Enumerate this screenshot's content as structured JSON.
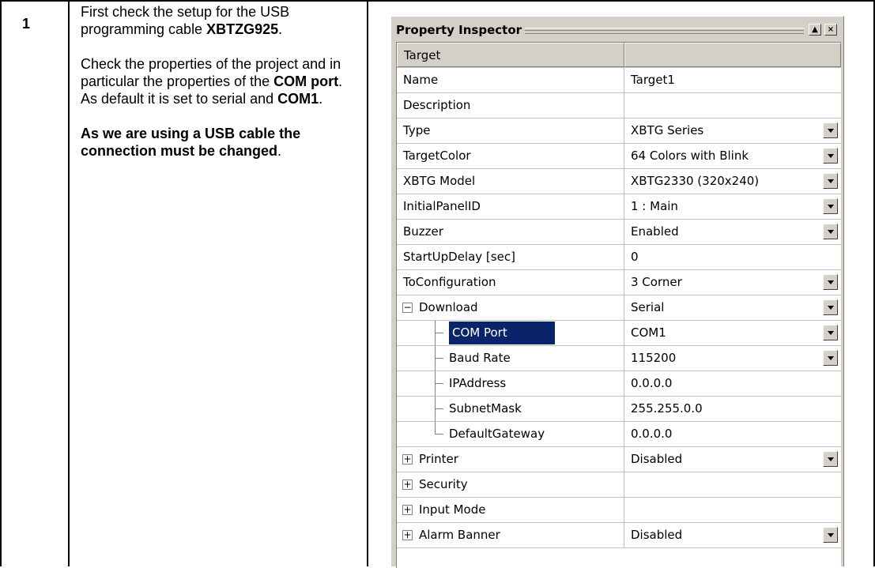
{
  "step": {
    "number": "1"
  },
  "instructions": {
    "p1_prefix": "First check the setup for the USB programming cable ",
    "p1_bold": "XBTZG925",
    "p1_suffix": ".",
    "p2_a": "Check the properties of the project and in particular the properties of the ",
    "p2_bold1": "COM port",
    "p2_b": ". As default it is set to serial and ",
    "p2_bold2": "COM1",
    "p2_c": ".",
    "p3_bold": "As we are using a USB cable the connection must be changed",
    "p3_suffix": "."
  },
  "inspector": {
    "title": "Property Inspector",
    "header": {
      "name": "Target",
      "value": ""
    },
    "rows": [
      {
        "name": "Name",
        "value": "Target1",
        "dropdown": false
      },
      {
        "name": "Description",
        "value": "",
        "dropdown": false
      },
      {
        "name": "Type",
        "value": "XBTG Series",
        "dropdown": true
      },
      {
        "name": "TargetColor",
        "value": "64 Colors with Blink",
        "dropdown": true
      },
      {
        "name": "XBTG Model",
        "value": "XBTG2330 (320x240)",
        "dropdown": true
      },
      {
        "name": "InitialPanelID",
        "value": "1 : Main",
        "dropdown": true
      },
      {
        "name": "Buzzer",
        "value": "Enabled",
        "dropdown": true
      },
      {
        "name": "StartUpDelay [sec]",
        "value": "0",
        "dropdown": false
      },
      {
        "name": "ToConfiguration",
        "value": "3 Corner",
        "dropdown": true
      },
      {
        "name": "Download",
        "value": "Serial",
        "dropdown": true,
        "expander": "−"
      },
      {
        "name": "COM Port",
        "value": "COM1",
        "dropdown": true,
        "child": true,
        "selected": true
      },
      {
        "name": "Baud Rate",
        "value": "115200",
        "dropdown": true,
        "child": true
      },
      {
        "name": "IPAddress",
        "value": "0.0.0.0",
        "dropdown": false,
        "child": true
      },
      {
        "name": "SubnetMask",
        "value": "255.255.0.0",
        "dropdown": false,
        "child": true
      },
      {
        "name": "DefaultGateway",
        "value": "0.0.0.0",
        "dropdown": false,
        "child": true,
        "last": true
      },
      {
        "name": "Printer",
        "value": "Disabled",
        "dropdown": true,
        "expander": "+"
      },
      {
        "name": "Security",
        "value": "",
        "dropdown": false,
        "expander": "+"
      },
      {
        "name": "Input Mode",
        "value": "",
        "dropdown": false,
        "expander": "+"
      },
      {
        "name": "Alarm Banner",
        "value": "Disabled",
        "dropdown": true,
        "expander": "+"
      }
    ]
  }
}
